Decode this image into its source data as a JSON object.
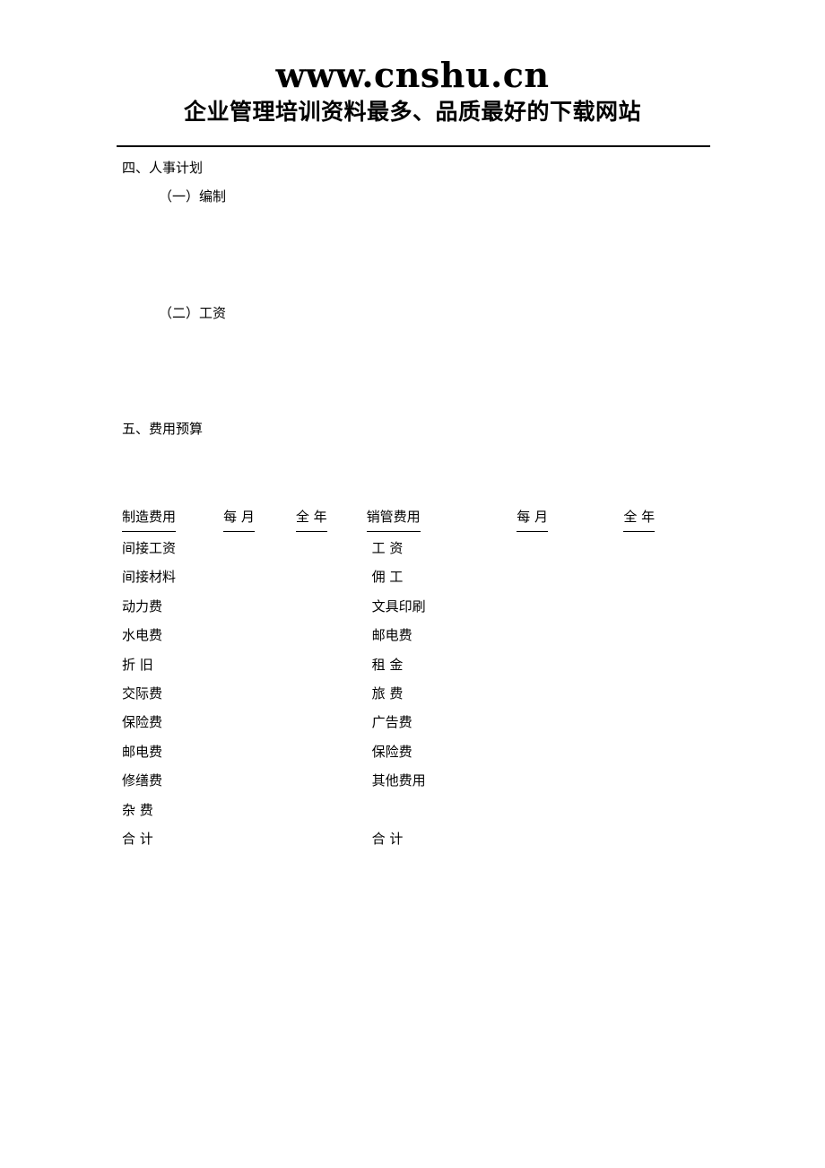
{
  "banner": {
    "title": "www.cnshu.cn",
    "subtitle": "企业管理培训资料最多、品质最好的下载网站"
  },
  "outline": {
    "section_personnel": "四、人事计划",
    "sub_staffing": "（一）编制",
    "sub_salary": "（二）工资",
    "section_budget": "五、费用预算"
  },
  "budget_table": {
    "headers": {
      "mfg_name": "制造费用",
      "mfg_month": "每 月",
      "mfg_year": "全 年",
      "sel_name": "销管费用",
      "sel_month": "每 月",
      "sel_year": "全 年"
    },
    "rows": [
      {
        "mfg_name": "间接工资",
        "mfg_month": "",
        "mfg_year": "",
        "sel_name": "工 资",
        "sel_month": "",
        "sel_year": ""
      },
      {
        "mfg_name": "间接材料",
        "mfg_month": "",
        "mfg_year": "",
        "sel_name": "佣 工",
        "sel_month": "",
        "sel_year": ""
      },
      {
        "mfg_name": "动力费",
        "mfg_month": "",
        "mfg_year": "",
        "sel_name": "文具印刷",
        "sel_month": "",
        "sel_year": ""
      },
      {
        "mfg_name": "水电费",
        "mfg_month": "",
        "mfg_year": "",
        "sel_name": "邮电费",
        "sel_month": "",
        "sel_year": ""
      },
      {
        "mfg_name": "折 旧",
        "mfg_month": "",
        "mfg_year": "",
        "sel_name": "租 金",
        "sel_month": "",
        "sel_year": ""
      },
      {
        "mfg_name": "交际费",
        "mfg_month": "",
        "mfg_year": "",
        "sel_name": "旅 费",
        "sel_month": "",
        "sel_year": ""
      },
      {
        "mfg_name": "保险费",
        "mfg_month": "",
        "mfg_year": "",
        "sel_name": "广告费",
        "sel_month": "",
        "sel_year": ""
      },
      {
        "mfg_name": "邮电费",
        "mfg_month": "",
        "mfg_year": "",
        "sel_name": "保险费",
        "sel_month": "",
        "sel_year": ""
      },
      {
        "mfg_name": "修缮费",
        "mfg_month": "",
        "mfg_year": "",
        "sel_name": "其他费用",
        "sel_month": "",
        "sel_year": ""
      },
      {
        "mfg_name": "杂 费",
        "mfg_month": "",
        "mfg_year": "",
        "sel_name": "",
        "sel_month": "",
        "sel_year": ""
      },
      {
        "mfg_name": "合 计",
        "mfg_month": "",
        "mfg_year": "",
        "sel_name": "合 计",
        "sel_month": "",
        "sel_year": ""
      }
    ]
  }
}
